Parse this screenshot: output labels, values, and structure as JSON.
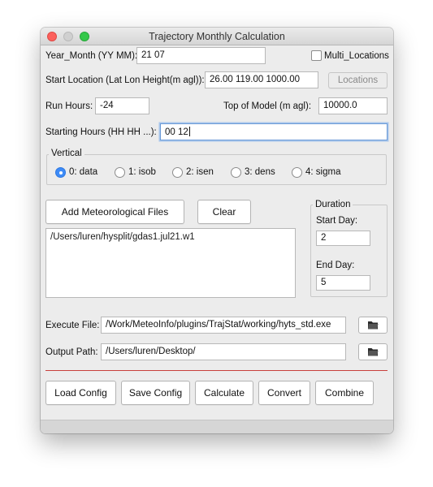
{
  "window": {
    "title": "Trajectory Monthly Calculation"
  },
  "year_month": {
    "label": "Year_Month (YY MM):",
    "value": "21 07"
  },
  "multi_locations": {
    "label": "Multi_Locations",
    "checked": false
  },
  "start_location": {
    "label": "Start Location (Lat Lon Height(m agl)):",
    "value": "26.00 119.00 1000.00",
    "locations_button": "Locations"
  },
  "run_hours": {
    "label": "Run Hours:",
    "value": "-24"
  },
  "top_of_model": {
    "label": "Top of Model (m agl):",
    "value": "10000.0"
  },
  "starting_hours": {
    "label": "Starting Hours (HH HH ...):",
    "value": "00 12"
  },
  "vertical": {
    "legend": "Vertical",
    "selected": "0: data",
    "options": [
      "0: data",
      "1: isob",
      "2: isen",
      "3: dens",
      "4: sigma"
    ]
  },
  "met_files": {
    "add_button": "Add Meteorological Files",
    "clear_button": "Clear",
    "files": [
      "/Users/luren/hysplit/gdas1.jul21.w1"
    ]
  },
  "duration": {
    "legend": "Duration",
    "start_label": "Start Day:",
    "start_value": "2",
    "end_label": "End Day:",
    "end_value": "5"
  },
  "execute_file": {
    "label": "Execute File:",
    "value": "/Work/MeteoInfo/plugins/TrajStat/working/hyts_std.exe",
    "icon": "folder-icon"
  },
  "output_path": {
    "label": "Output Path:",
    "value": "/Users/luren/Desktop/",
    "icon": "folder-icon"
  },
  "actions": {
    "load_config": "Load Config",
    "save_config": "Save Config",
    "calculate": "Calculate",
    "convert": "Convert",
    "combine": "Combine"
  },
  "colors": {
    "accent": "#3d8bf7",
    "separator": "#c9403c",
    "focus": "#6c9bd7"
  }
}
